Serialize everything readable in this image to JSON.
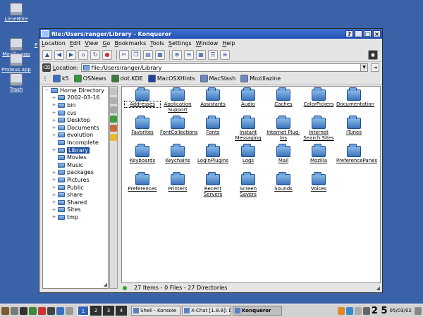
{
  "desktop": {
    "icons": [
      {
        "label": "LimeWire",
        "name": "limewire"
      },
      {
        "label": "Mozilla app",
        "name": "mozilla-app"
      },
      {
        "label": "Proteus.app",
        "name": "proteus-app"
      },
      {
        "label": "Trash",
        "name": "trash"
      }
    ],
    "cut_label": "P"
  },
  "window": {
    "title": "file:/Users/ranger/Library - Konqueror",
    "title_buttons": [
      "?",
      "_",
      "□",
      "×"
    ]
  },
  "menu": [
    "Location",
    "Edit",
    "View",
    "Go",
    "Bookmarks",
    "Tools",
    "Settings",
    "Window",
    "Help"
  ],
  "location": {
    "label": "Location:",
    "value": "file:/Users/ranger/Library"
  },
  "bookmarks": [
    {
      "label": "k5",
      "color": "#3a6fc2"
    },
    {
      "label": "OSNews",
      "color": "#2f9a3a"
    },
    {
      "label": "dot.KDE",
      "color": "#3a7a3a"
    },
    {
      "label": "MacOSXHints",
      "color": "#1f3fa8"
    },
    {
      "label": "MacSlash",
      "color": "#6b88c8"
    },
    {
      "label": "Mozillazine",
      "color": "#6b88c8"
    }
  ],
  "tree": {
    "root": "Home Directory",
    "items": [
      {
        "label": "2002-03-16",
        "expander": "+"
      },
      {
        "label": "bin",
        "expander": "+"
      },
      {
        "label": "cvs",
        "expander": "+"
      },
      {
        "label": "Desktop",
        "expander": "+"
      },
      {
        "label": "Documents",
        "expander": "+"
      },
      {
        "label": "evolution",
        "expander": "+"
      },
      {
        "label": "Incomplete",
        "expander": ""
      },
      {
        "label": "Library",
        "expander": "+"
      },
      {
        "label": "Movies",
        "expander": ""
      },
      {
        "label": "Music",
        "expander": ""
      },
      {
        "label": "packages",
        "expander": "+"
      },
      {
        "label": "Pictures",
        "expander": "+"
      },
      {
        "label": "Public",
        "expander": "+"
      },
      {
        "label": "share",
        "expander": "+"
      },
      {
        "label": "Shared",
        "expander": "+"
      },
      {
        "label": "Sites",
        "expander": "+"
      },
      {
        "label": "tmp",
        "expander": "+"
      }
    ],
    "selected": "Library"
  },
  "files": [
    {
      "line1": "Addresses",
      "line2": ""
    },
    {
      "line1": "Application",
      "line2": "Support"
    },
    {
      "line1": "Assistants",
      "line2": ""
    },
    {
      "line1": "Audio",
      "line2": ""
    },
    {
      "line1": "Caches",
      "line2": ""
    },
    {
      "line1": "ColorPickers",
      "line2": ""
    },
    {
      "line1": "Documentation",
      "line2": ""
    },
    {
      "line1": "Favorites",
      "line2": ""
    },
    {
      "line1": "FontCollections",
      "line2": ""
    },
    {
      "line1": "Fonts",
      "line2": ""
    },
    {
      "line1": "Instant",
      "line2": "Messaging"
    },
    {
      "line1": "Internet Plug-",
      "line2": "Ins"
    },
    {
      "line1": "Internet",
      "line2": "Search Sites"
    },
    {
      "line1": "iTunes",
      "line2": ""
    },
    {
      "line1": "Keyboards",
      "line2": ""
    },
    {
      "line1": "Keychains",
      "line2": ""
    },
    {
      "line1": "LoginPlugins",
      "line2": ""
    },
    {
      "line1": "Logs",
      "line2": ""
    },
    {
      "line1": "Mail",
      "line2": ""
    },
    {
      "line1": "Mozilla",
      "line2": ""
    },
    {
      "line1": "PreferencePanes",
      "line2": ""
    },
    {
      "line1": "Preferences",
      "line2": ""
    },
    {
      "line1": "Printers",
      "line2": ""
    },
    {
      "line1": "Recent",
      "line2": "Servers"
    },
    {
      "line1": "Screen",
      "line2": "Savers"
    },
    {
      "line1": "Sounds",
      "line2": ""
    },
    {
      "line1": "Voices",
      "line2": ""
    }
  ],
  "status": "27 Items - 0 Files - 27 Directories",
  "taskbar": {
    "pages": [
      "1",
      "2",
      "3",
      "4"
    ],
    "active_page": "1",
    "tasks": [
      {
        "label": "Shell - Konsole",
        "active": false
      },
      {
        "label": "X-Chat [1.8.8]: Dixie",
        "active": false
      },
      {
        "label": "Konqueror",
        "active": true
      }
    ],
    "clock_big": "2 5",
    "date": "05/03/02"
  }
}
